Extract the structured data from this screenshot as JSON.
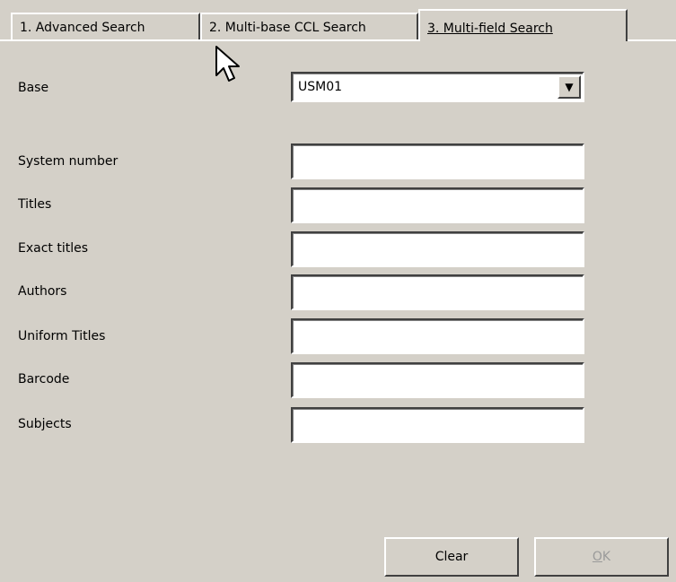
{
  "tabs": [
    {
      "label": "1. Advanced Search",
      "active": false
    },
    {
      "label": "2. Multi-base CCL Search",
      "active": false
    },
    {
      "label": "3. Multi-field Search",
      "active": true
    }
  ],
  "form": {
    "base": {
      "label": "Base",
      "value": "USM01"
    },
    "fields": [
      {
        "label": "System number",
        "value": ""
      },
      {
        "label": "Titles",
        "value": ""
      },
      {
        "label": "Exact titles",
        "value": ""
      },
      {
        "label": "Authors",
        "value": ""
      },
      {
        "label": "Uniform Titles",
        "value": ""
      },
      {
        "label": "Barcode",
        "value": ""
      },
      {
        "label": "Subjects",
        "value": ""
      }
    ]
  },
  "buttons": {
    "clear": "Clear",
    "ok_mnemonic": "O",
    "ok_rest": "K",
    "ok_disabled": true
  },
  "icons": {
    "dropdown": "chevron-down-icon",
    "cursor": "mouse-pointer-icon"
  },
  "colors": {
    "background": "#d4d0c8",
    "field_bg": "#ffffff",
    "disabled_text": "#9a9a9a"
  }
}
